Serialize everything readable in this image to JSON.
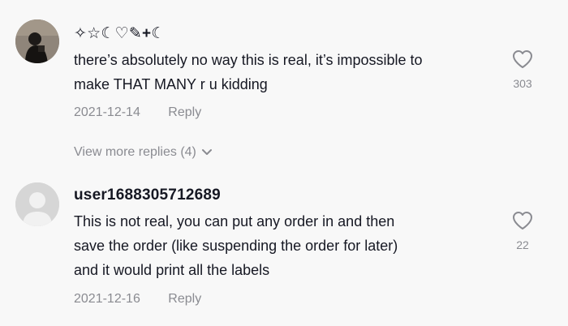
{
  "comments": [
    {
      "username": "✧☆☾♡✎+☾",
      "text_lines": [
        "there’s absolutely no way this is real, it’s impossible to",
        "make THAT MANY r u kidding"
      ],
      "date": "2021-12-14",
      "reply_label": "Reply",
      "likes": "303",
      "view_more_label": "View more replies (4)"
    },
    {
      "username": "user1688305712689",
      "text_lines": [
        "This is not real, you can put any order in and then",
        "save the order (like suspending the order for later)",
        "and it would print all the labels"
      ],
      "date": "2021-12-16",
      "reply_label": "Reply",
      "likes": "22"
    }
  ],
  "icons": {
    "like": "heart-outline-icon",
    "expand": "chevron-down-icon",
    "default_avatar": "user-silhouette-icon"
  },
  "colors": {
    "background": "#f8f8f8",
    "primary_text": "#161823",
    "secondary_text": "#8a8b91"
  }
}
